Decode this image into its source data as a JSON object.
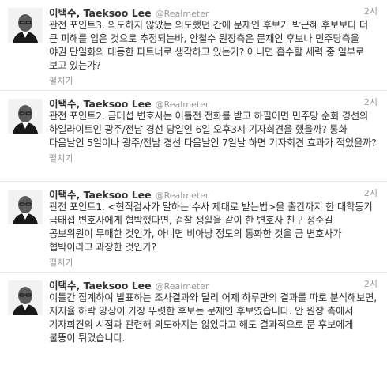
{
  "tweets": [
    {
      "name": "이택수, Taeksoo Lee",
      "handle": "@Realmeter",
      "time": "2시",
      "text": "관전 포인트3. 의도하지 않았든 의도했던 간에 문재인 후보가 박근혜 후보보다 더 큰 피해를 입은 것으로 추정되는바, 안철수 원장측은 문재인 후보나 민주당측을 야권 단일화의 대등한 파트너로 생각하고 있는가? 아니면 흡수할 세력 중 일부로 보고 있는가?",
      "expand": "펼치기"
    },
    {
      "name": "이택수, Taeksoo Lee",
      "handle": "@Realmeter",
      "time": "2시",
      "text": "관전 포인트2. 금태섭 변호사는 이틀전 전화를 받고 하필이면 민주당 순회 경선의 하일라이트인 광주/전남 경선 당일인 6일 오후3시 기자회견을 했을까? 통화 다음날인 5일이나 광주/전남 경선 다음날인 7일날 하면 기자회견 효과가 적었을까?",
      "expand": "펼치기"
    },
    {
      "name": "이택수, Taeksoo Lee",
      "handle": "@Realmeter",
      "time": "2시",
      "text": "관전 포인트1. <현직검사가 말하는 수사 제대로 받는법>을 출간까지 한 대학동기 금태섭 변호사에게 협박했다면, 검찰 생활을 같이 한 변호사 친구 정준길 공보위원이 무매한 것인가, 아니면 비아냥 정도의 통화한 것을 금 변호사가 협박이라고 과장한 것인가?",
      "expand": "펼치기"
    },
    {
      "name": "이택수, Taeksoo Lee",
      "handle": "@Realmeter",
      "time": "2시",
      "text": "이틀간 집계하여 발표하는 조사결과와 달리 어제 하루만의 결과를 따로 분석해보면, 지지율 하락 양상이 가장 뚜렷한 후보는 문재인 후보였습니다. 안 원장 측에서 기자회견의 시점과 관련해 의도하지는 않았다고 해도 결과적으로 문 후보에게 불똥이 튀었습니다.",
      "expand": ""
    }
  ]
}
